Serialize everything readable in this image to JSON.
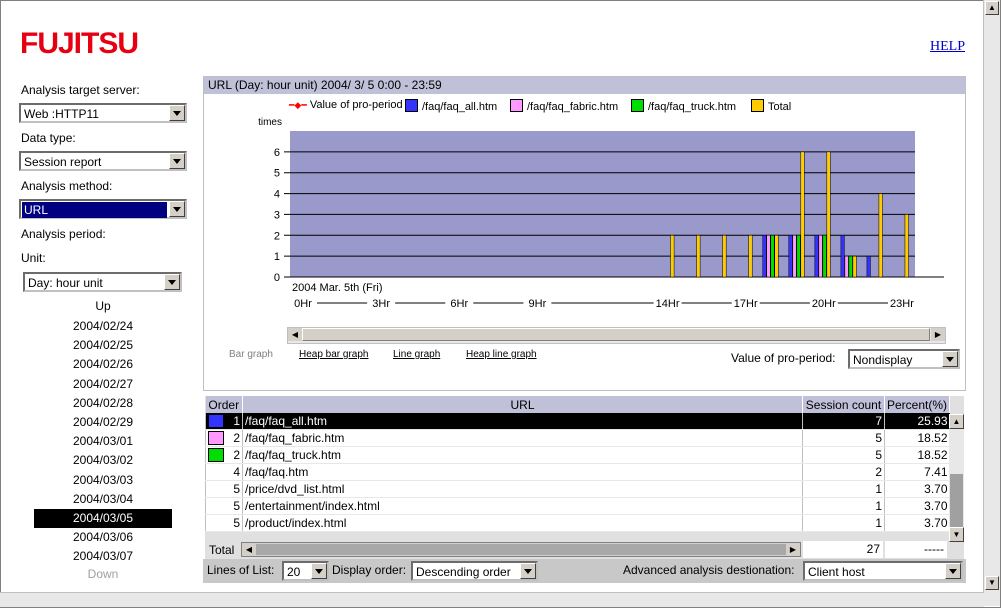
{
  "brand": "FUJITSU",
  "help_link": "HELP",
  "sidebar": {
    "server_label": "Analysis target server:",
    "server_value": "Web  :HTTP11",
    "datatype_label": "Data type:",
    "datatype_value": "Session report",
    "method_label": "Analysis method:",
    "method_value": "URL",
    "period_label": "Analysis period:",
    "unit_label": "Unit:",
    "unit_value": "Day: hour unit",
    "up": "Up",
    "down": "Down",
    "dates": [
      "2004/02/24",
      "2004/02/25",
      "2004/02/26",
      "2004/02/27",
      "2004/02/28",
      "2004/02/29",
      "2004/03/01",
      "2004/03/02",
      "2004/03/03",
      "2004/03/04",
      "2004/03/05",
      "2004/03/06",
      "2004/03/07"
    ],
    "selected_date": "2004/03/05"
  },
  "chart_panel": {
    "title": "URL  (Day: hour unit)  2004/ 3/ 5  0:00 - 23:59",
    "graph_modes": [
      "Bar graph",
      "Heap bar graph",
      "Line graph",
      "Heap line graph"
    ],
    "pro_period_label": "Value of pro-period:",
    "pro_period_value": "Nondisplay"
  },
  "chart_data": {
    "type": "bar",
    "ylabel": "times",
    "xlabel": "2004 Mar. 5th (Fri)",
    "ylim": [
      0,
      7
    ],
    "yticks": [
      0,
      1,
      2,
      3,
      4,
      5,
      6
    ],
    "xticklabels": [
      "0Hr",
      "3Hr",
      "6Hr",
      "9Hr",
      "14Hr",
      "17Hr",
      "20Hr",
      "23Hr"
    ],
    "grid": true,
    "legend_position": "top",
    "colors": {
      "background": "#9999cc",
      "faq_all": "#3333ff",
      "faq_fabric": "#ff99ff",
      "faq_truck": "#00dd00",
      "total": "#ffcc00",
      "pro": "#ff0000"
    },
    "series": [
      {
        "name": "Value of pro-period",
        "kind": "line",
        "values": []
      },
      {
        "name": "/faq/faq_all.htm",
        "x": [
          18,
          19,
          20,
          21,
          22
        ],
        "values": [
          2,
          2,
          2,
          2,
          1
        ]
      },
      {
        "name": "/faq/faq_fabric.htm",
        "x": [
          18,
          19,
          20,
          21
        ],
        "values": [
          2,
          2,
          2,
          1
        ]
      },
      {
        "name": "/faq/faq_truck.htm",
        "x": [
          18,
          19,
          20,
          21
        ],
        "values": [
          2,
          2,
          2,
          1
        ]
      },
      {
        "name": "Total",
        "x": [
          14,
          15,
          16,
          17,
          18,
          19,
          20,
          21,
          22,
          23
        ],
        "values": [
          2,
          2,
          2,
          2,
          2,
          6,
          6,
          1,
          4,
          3
        ]
      }
    ]
  },
  "table": {
    "headers": [
      "Order",
      "URL",
      "Session count",
      "Percent(%)"
    ],
    "rows": [
      {
        "order": "1",
        "color": "#3333ff",
        "url": "/faq/faq_all.htm",
        "count": "7",
        "pct": "25.93",
        "selected": true
      },
      {
        "order": "2",
        "color": "#ff99ff",
        "url": "/faq/faq_fabric.htm",
        "count": "5",
        "pct": "18.52"
      },
      {
        "order": "2",
        "color": "#00dd00",
        "url": "/faq/faq_truck.htm",
        "count": "5",
        "pct": "18.52"
      },
      {
        "order": "4",
        "url": "/faq/faq.htm",
        "count": "2",
        "pct": "7.41"
      },
      {
        "order": "5",
        "url": "/price/dvd_list.html",
        "count": "1",
        "pct": "3.70"
      },
      {
        "order": "5",
        "url": "/entertainment/index.html",
        "count": "1",
        "pct": "3.70"
      },
      {
        "order": "5",
        "url": "/product/index.html",
        "count": "1",
        "pct": "3.70"
      }
    ],
    "total_label": "Total",
    "total_count": "27",
    "total_pct": "-----"
  },
  "footer": {
    "lines_label": "Lines of List:",
    "lines_value": "20",
    "order_label": "Display order:",
    "order_value": "Descending order",
    "adv_label": "Advanced analysis destionation:",
    "adv_value": "Client host"
  }
}
